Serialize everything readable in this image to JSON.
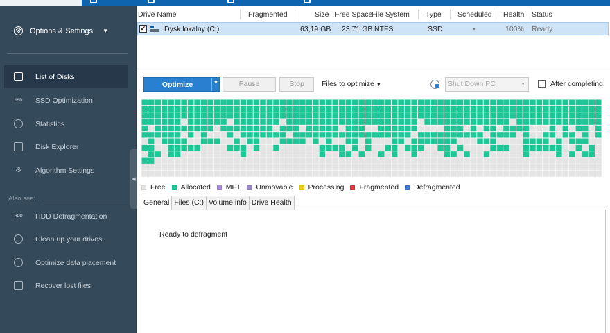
{
  "sidebar": {
    "options_label": "Options & Settings",
    "items": [
      {
        "label": "List of Disks",
        "icon": "list-of-disks-icon",
        "active": true
      },
      {
        "label": "SSD Optimization",
        "icon": "ssd-icon"
      },
      {
        "label": "Statistics",
        "icon": "pie-chart-icon"
      },
      {
        "label": "Disk Explorer",
        "icon": "disk-explorer-icon"
      },
      {
        "label": "Algorithm Settings",
        "icon": "algorithm-gear-icon"
      }
    ],
    "also_see_label": "Also see:",
    "also_see_items": [
      {
        "label": "HDD Defragmentation",
        "icon": "hdd-icon"
      },
      {
        "label": "Clean up your drives",
        "icon": "cleanup-icon"
      },
      {
        "label": "Optimize data placement",
        "icon": "optimize-placement-icon"
      },
      {
        "label": "Recover lost files",
        "icon": "recover-files-icon"
      }
    ]
  },
  "drives_table": {
    "columns": [
      "Drive Name",
      "Fragmented",
      "Size",
      "Free Space",
      "File System",
      "Type",
      "Scheduled",
      "Health",
      "Status"
    ],
    "rows": [
      {
        "checked": true,
        "name": "Dysk lokalny (C:)",
        "fragmented": "",
        "size": "63,19 GB",
        "free_space": "23,71 GB",
        "file_system": "NTFS",
        "type": "SSD",
        "scheduled": "•",
        "health": "100%",
        "status": "Ready"
      }
    ]
  },
  "toolbar": {
    "optimize_label": "Optimize",
    "pause_label": "Pause",
    "stop_label": "Stop",
    "files_to_optimize_label": "Files to optimize",
    "shutdown_value": "Shut Down PC",
    "after_completing_label": "After completing:"
  },
  "cluster_map": {
    "columns": 70,
    "rows": 12,
    "allocated_color": "#1ec896",
    "free_color": "#e4e4e4",
    "filled_rows": 9
  },
  "legend": [
    {
      "label": "Free",
      "color": "#e6e6e6"
    },
    {
      "label": "Allocated",
      "color": "#1ec896"
    },
    {
      "label": "MFT",
      "color": "#a98ce6"
    },
    {
      "label": "Unmovable",
      "color": "#9b8ad2"
    },
    {
      "label": "Processing",
      "color": "#f0cc1e"
    },
    {
      "label": "Fragmented",
      "color": "#e03c3c"
    },
    {
      "label": "Defragmented",
      "color": "#3c78d8"
    }
  ],
  "tabs": [
    {
      "label": "General",
      "active": true
    },
    {
      "label": "Files (C:)"
    },
    {
      "label": "Volume info"
    },
    {
      "label": "Drive Health"
    }
  ],
  "status_message": "Ready to defragment"
}
